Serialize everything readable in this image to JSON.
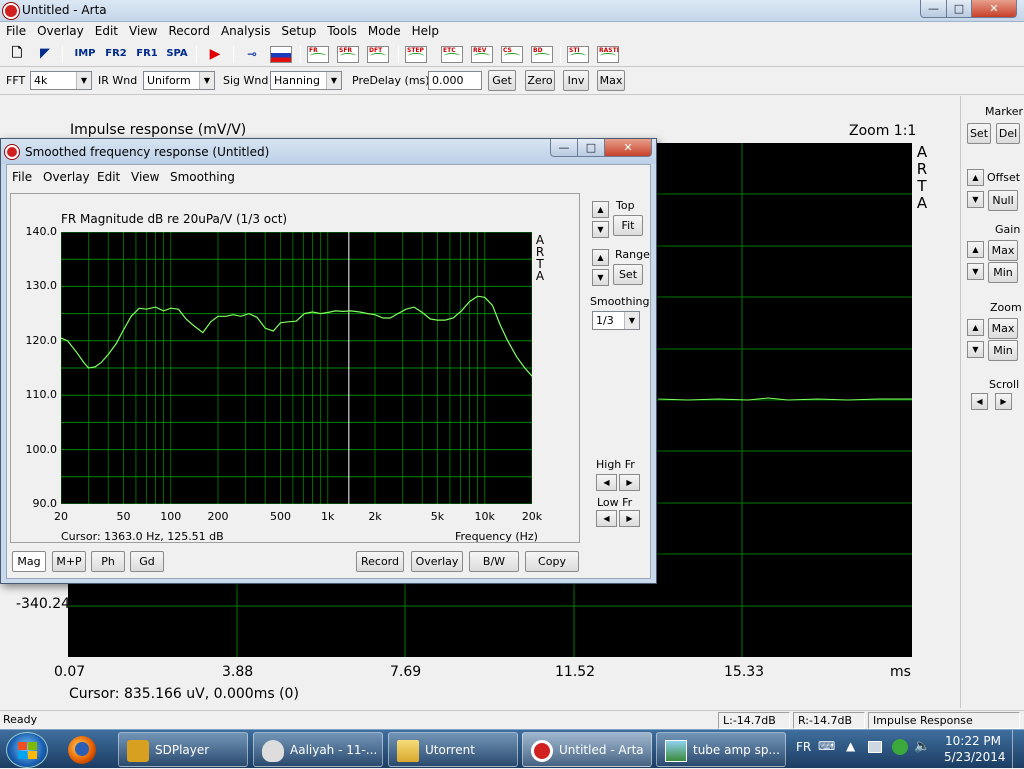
{
  "window": {
    "title": "Untitled - Arta",
    "min": "—",
    "max": "□",
    "close": "✕"
  },
  "menu": [
    "File",
    "Overlay",
    "Edit",
    "View",
    "Record",
    "Analysis",
    "Setup",
    "Tools",
    "Mode",
    "Help"
  ],
  "toolbar": {
    "imp": "IMP",
    "fr2": "FR2",
    "fr1": "FR1",
    "spa": "SPA",
    "tools": [
      "FR",
      "SFR",
      "DFT",
      "STEP",
      "ETC",
      "REV",
      "CS",
      "BD",
      "STI",
      "RASTI"
    ]
  },
  "settings": {
    "fft_label": "FFT",
    "fft_value": "4k",
    "irwnd_label": "IR Wnd",
    "irwnd_value": "Uniform",
    "sigwnd_label": "Sig Wnd",
    "sigwnd_value": "Hanning",
    "predelay_label": "PreDelay (ms)",
    "predelay_value": "0.000",
    "get": "Get",
    "zero": "Zero",
    "inv": "Inv",
    "max": "Max"
  },
  "impulse": {
    "title": "Impulse response (mV/V)",
    "zoom": "Zoom 1:1",
    "brand": [
      "A",
      "R",
      "T",
      "A"
    ],
    "y_min_label": "-340.24",
    "x_ticks": [
      "0.07",
      "3.88",
      "7.69",
      "11.52",
      "15.33"
    ],
    "x_unit": "ms",
    "cursor": "Cursor: 835.166 uV, 0.000ms (0)"
  },
  "right_panel": {
    "marker": "Marker",
    "set": "Set",
    "del": "Del",
    "offset": "Offset",
    "null": "Null",
    "gain": "Gain",
    "gain_max": "Max",
    "gain_min": "Min",
    "zoom": "Zoom",
    "zoom_max": "Max",
    "zoom_min": "Min",
    "scroll": "Scroll"
  },
  "status": {
    "ready": "Ready",
    "left": "L:-14.7dB",
    "right": "R:-14.7dB",
    "mode": "Impulse Response"
  },
  "fr_window": {
    "title": "Smoothed frequency response (Untitled)",
    "menu": [
      "File",
      "Overlay",
      "Edit",
      "View",
      "Smoothing"
    ],
    "plot_title": "FR Magnitude dB re 20uPa/V (1/3 oct)",
    "cursor": "Cursor: 1363.0 Hz, 125.51 dB",
    "xlabel": "Frequency (Hz)",
    "top": "Top",
    "fit": "Fit",
    "range": "Range",
    "set": "Set",
    "smoothing": "Smoothing",
    "smoothing_value": "1/3",
    "high_fr": "High Fr",
    "low_fr": "Low Fr",
    "tabs": [
      "Mag",
      "M+P",
      "Ph",
      "Gd"
    ],
    "record": "Record",
    "overlay": "Overlay",
    "bw": "B/W",
    "copy": "Copy",
    "brand": [
      "A",
      "R",
      "T",
      "A"
    ]
  },
  "taskbar": {
    "items": [
      "SDPlayer",
      "Aaliyah - 11-...",
      "Utorrent",
      "Untitled - Arta",
      "tube amp sp..."
    ],
    "lang": "FR",
    "time": "10:22 PM",
    "date": "5/23/2014"
  },
  "chart_data": {
    "type": "line",
    "title": "FR Magnitude dB re 20uPa/V (1/3 oct)",
    "xlabel": "Frequency (Hz)",
    "ylabel": "",
    "x_scale": "log",
    "xlim": [
      20,
      20000
    ],
    "ylim": [
      90,
      140
    ],
    "x_ticks": [
      20,
      50,
      100,
      200,
      500,
      1000,
      2000,
      5000,
      10000,
      20000
    ],
    "x_tick_labels": [
      "20",
      "50",
      "100",
      "200",
      "500",
      "1k",
      "2k",
      "5k",
      "10k",
      "20k"
    ],
    "y_ticks": [
      90,
      100,
      110,
      120,
      130,
      140
    ],
    "y_tick_labels": [
      "90.0",
      "100.0",
      "110.0",
      "120.0",
      "130.0",
      "140.0"
    ],
    "cursor_x": 1363,
    "series": [
      {
        "color": "#7fff5f",
        "x": [
          20,
          22,
          25,
          28,
          30,
          33,
          36,
          40,
          45,
          50,
          56,
          63,
          70,
          80,
          90,
          100,
          112,
          125,
          140,
          160,
          180,
          200,
          225,
          250,
          280,
          315,
          355,
          400,
          450,
          500,
          560,
          630,
          710,
          800,
          900,
          1000,
          1120,
          1250,
          1400,
          1600,
          1800,
          2000,
          2250,
          2500,
          2800,
          3150,
          3550,
          4000,
          4500,
          5000,
          5600,
          6300,
          7100,
          8000,
          9000,
          10000,
          11200,
          12500,
          14000,
          16000,
          18000,
          20000
        ],
        "y": [
          120.5,
          120,
          118,
          116,
          115,
          115.2,
          116,
          117.5,
          119.5,
          122,
          124.5,
          126,
          125.8,
          126.2,
          125.5,
          126,
          125.8,
          124,
          122.8,
          121.5,
          123.5,
          124.5,
          124.5,
          124.8,
          124.5,
          125,
          124.3,
          122.3,
          121.8,
          123.3,
          123.5,
          123.6,
          125,
          125.3,
          125,
          125.2,
          125.5,
          125.4,
          125.5,
          125.3,
          125,
          124.8,
          124.2,
          124.2,
          125,
          125.8,
          126.2,
          125.2,
          124,
          123.8,
          123.8,
          124.2,
          125.5,
          127.2,
          128.2,
          128,
          126.5,
          123,
          120,
          117,
          115,
          113.5
        ]
      }
    ]
  }
}
